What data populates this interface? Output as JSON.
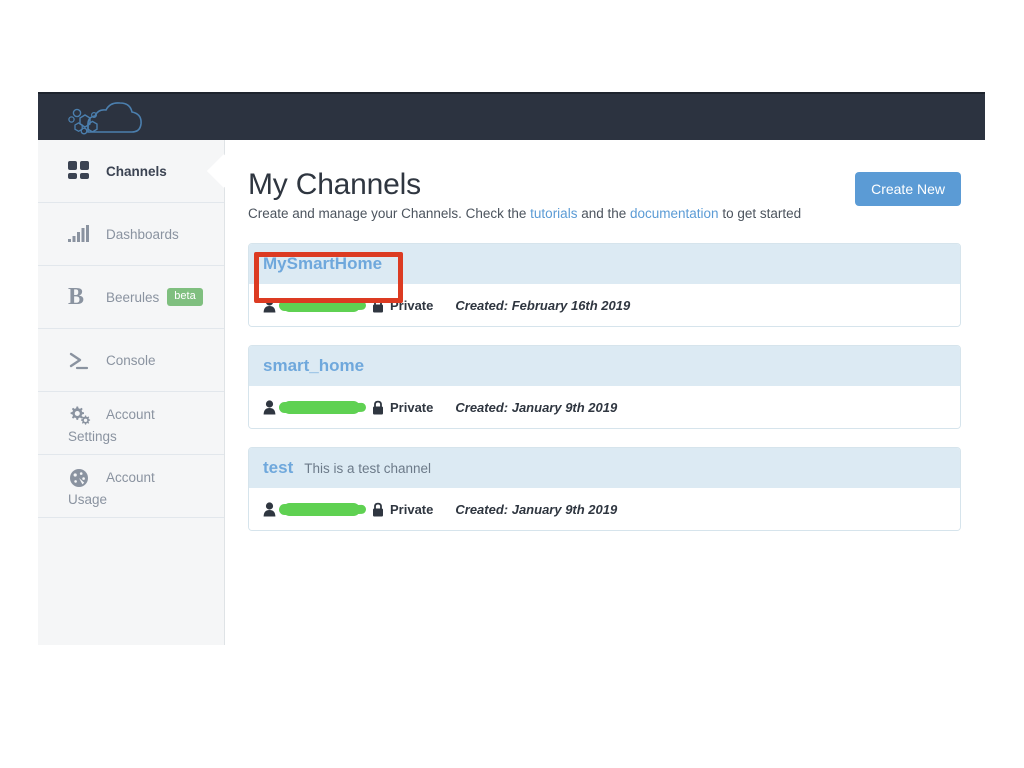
{
  "app": {
    "logo_name": "beebotte-cloud-logo"
  },
  "sidebar": {
    "items": [
      {
        "label": "Channels",
        "icon": "grid-squares-icon",
        "active": true,
        "badge": null
      },
      {
        "label": "Dashboards",
        "icon": "bar-chart-icon",
        "active": false,
        "badge": null
      },
      {
        "label": "Beerules",
        "icon": "letter-b-icon",
        "active": false,
        "badge": "beta"
      },
      {
        "label": "Console",
        "icon": "terminal-prompt-icon",
        "active": false,
        "badge": null
      },
      {
        "label": "Account",
        "label_second": "Settings",
        "icon": "gears-icon",
        "active": false,
        "badge": null
      },
      {
        "label": "Account",
        "label_second": "Usage",
        "icon": "gauge-icon",
        "active": false,
        "badge": null
      }
    ]
  },
  "main": {
    "title": "My Channels",
    "subtitle_part1": "Create and manage your Channels. Check the ",
    "subtitle_link1": "tutorials",
    "subtitle_part2": " and the ",
    "subtitle_link2": "documentation",
    "subtitle_part3": " to get started",
    "create_button": "Create New",
    "channels": [
      {
        "name": "MySmartHome",
        "description": "",
        "owner": "[redacted]",
        "privacy": "Private",
        "created": "Created: February 16th 2019",
        "annotated": true
      },
      {
        "name": "smart_home",
        "description": "",
        "owner": "[redacted]",
        "privacy": "Private",
        "created": "Created: January 9th 2019",
        "annotated": false
      },
      {
        "name": "test",
        "description": "This is a test channel",
        "owner": "[redacted]",
        "privacy": "Private",
        "created": "Created: January 9th 2019",
        "annotated": false
      }
    ]
  },
  "colors": {
    "topbar": "#2c3340",
    "accent_blue": "#5b9bd5",
    "channel_title": "#6fa8dc",
    "card_header": "#dceaf3",
    "badge_green": "#7fbf7f",
    "redaction_green": "#5fd152",
    "annotation_red": "#dc3b22"
  }
}
